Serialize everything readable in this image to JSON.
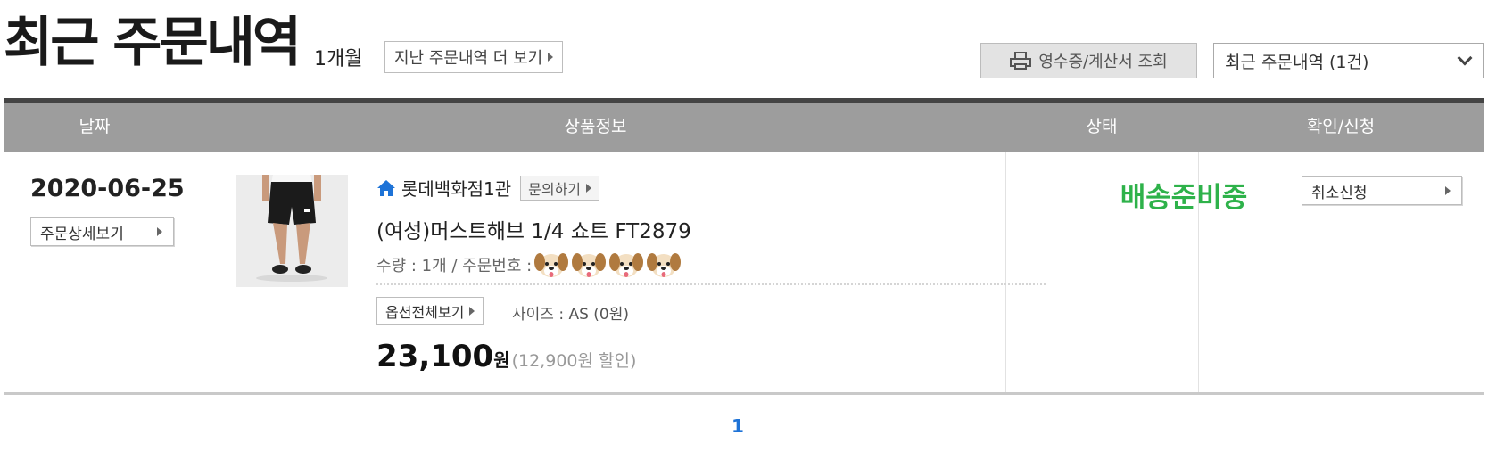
{
  "header": {
    "title": "최근 주문내역",
    "period": "1개월",
    "more_orders_label": "지난 주문내역 더 보기",
    "receipt_label": "영수증/계산서 조회",
    "filter_selected": "최근 주문내역 (1건)"
  },
  "table": {
    "columns": [
      "날짜",
      "상품정보",
      "상태",
      "확인/신청"
    ]
  },
  "order": {
    "date": "2020-06-25",
    "detail_button": "주문상세보기",
    "store": "롯데백화점1관",
    "inquiry_button": "문의하기",
    "product_name": "(여성)머스트해브 1/4 쇼트 FT2879",
    "quantity_text": "수량 : 1개 / 주문번호 :",
    "order_number_masked_icons": [
      "dog-emoji-icon",
      "dog-emoji-icon",
      "dog-emoji-icon",
      "dog-emoji-icon"
    ],
    "option_button": "옵션전체보기",
    "option_text": "사이즈 : AS (0원)",
    "price": "23,100",
    "price_unit": "원",
    "discount_text": "(12,900원 할인)",
    "status": "배송준비중",
    "status_color": "#2eb24a",
    "cancel_button": "취소신청"
  },
  "pagination": {
    "current_page": "1",
    "accent_color": "#1e73d7"
  }
}
